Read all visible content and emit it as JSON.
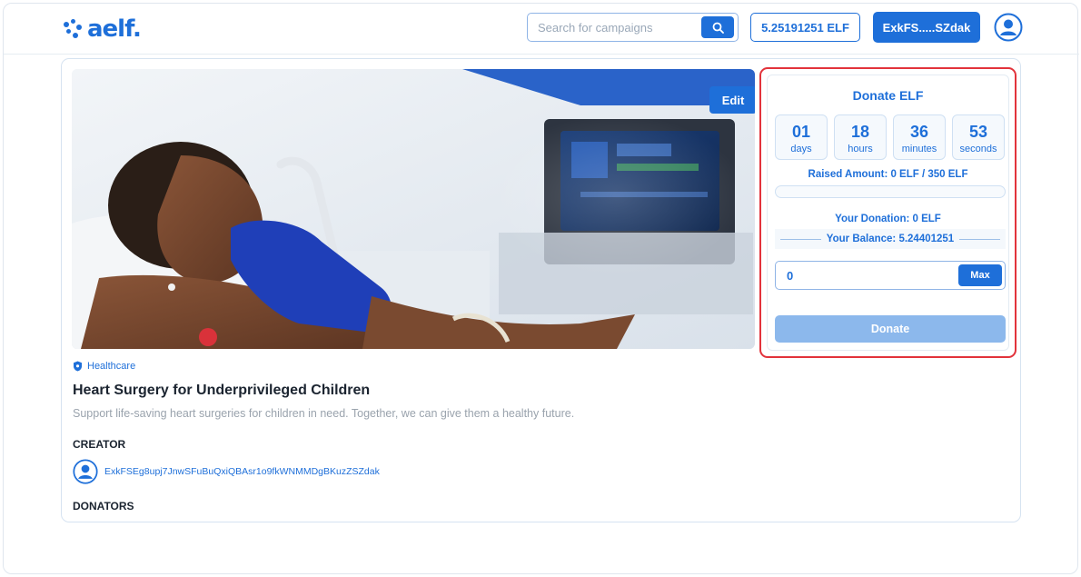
{
  "header": {
    "logo_text": "aelf.",
    "search_placeholder": "Search for campaigns",
    "balance_label": "5.25191251 ELF",
    "wallet_label": "ExkFS.....SZdak"
  },
  "campaign": {
    "edit_label": "Edit",
    "category": "Healthcare",
    "title": "Heart Surgery for Underprivileged Children",
    "description": "Support life-saving heart surgeries for children in need. Together, we can give them a healthy future.",
    "creator_heading": "CREATOR",
    "creator_address": "ExkFSEg8upj7JnwSFuBuQxiQBAsr1o9fkWNMMDgBKuzZSZdak",
    "donators_heading": "DONATORS"
  },
  "donate": {
    "title": "Donate ELF",
    "timer": [
      {
        "value": "01",
        "label": "days"
      },
      {
        "value": "18",
        "label": "hours"
      },
      {
        "value": "36",
        "label": "minutes"
      },
      {
        "value": "53",
        "label": "seconds"
      }
    ],
    "raised": "Raised Amount: 0 ELF / 350 ELF",
    "progress_fraction": 0,
    "your_donation": "Your Donation: 0 ELF",
    "your_balance": "Your Balance: 5.24401251",
    "amount_value": "0",
    "max_label": "Max",
    "donate_label": "Donate"
  },
  "colors": {
    "accent": "#1e6fd9",
    "highlight_border": "#e2333b",
    "disabled_button": "#8cb8ec"
  },
  "icons": [
    "aelf-logo-icon",
    "search-icon",
    "user-avatar-icon",
    "shield-icon"
  ]
}
